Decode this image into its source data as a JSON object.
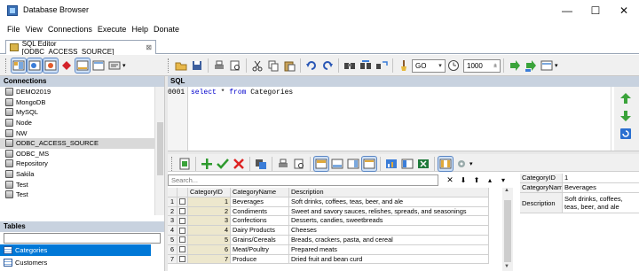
{
  "window": {
    "title": "Database Browser",
    "controls": [
      "—",
      "☐",
      "✕"
    ]
  },
  "menu": [
    "File",
    "View",
    "Connections",
    "Execute",
    "Help",
    "Donate"
  ],
  "tab": {
    "label": "SQL Editor [ODBC_ACCESS_SOURCE]",
    "close": "⊠"
  },
  "toolbar": {
    "go_value": "GO",
    "limit_value": "1000",
    "dropdown_arrow": "▾"
  },
  "connections": {
    "header": "Connections",
    "items": [
      "DEMO2019",
      "MongoDB",
      "MySQL",
      "Node",
      "NW",
      "ODBC_ACCESS_SOURCE",
      "ODBC_MS",
      "Repository",
      "Sakila",
      "Test",
      "Test"
    ],
    "selected": "ODBC_ACCESS_SOURCE"
  },
  "tables": {
    "header": "Tables",
    "filter_value": "",
    "items": [
      "Categories",
      "Customers"
    ],
    "selected": "Categories"
  },
  "sql": {
    "header": "SQL",
    "line_number": "0001",
    "keyword_select": "select",
    "star": " * ",
    "keyword_from": "from",
    "table": " Categories"
  },
  "grid": {
    "search_placeholder": "Search...",
    "columns": [
      "CategoryID",
      "CategoryName",
      "Description"
    ],
    "rows": [
      {
        "n": "1",
        "id": "1",
        "name": "Beverages",
        "desc": "Soft drinks, coffees, teas, beer, and ale"
      },
      {
        "n": "2",
        "id": "2",
        "name": "Condiments",
        "desc": "Sweet and savory sauces, relishes, spreads, and seasonings"
      },
      {
        "n": "3",
        "id": "3",
        "name": "Confections",
        "desc": "Desserts, candies, sweetbreads"
      },
      {
        "n": "4",
        "id": "4",
        "name": "Dairy Products",
        "desc": "Cheeses"
      },
      {
        "n": "5",
        "id": "5",
        "name": "Grains/Cereals",
        "desc": "Breads, crackers, pasta, and cereal"
      },
      {
        "n": "6",
        "id": "6",
        "name": "Meat/Poultry",
        "desc": "Prepared meats"
      },
      {
        "n": "7",
        "id": "7",
        "name": "Produce",
        "desc": "Dried fruit and bean curd"
      }
    ],
    "nav": [
      "✕",
      "⬇",
      "⬆",
      "▴",
      "▾"
    ]
  },
  "record": {
    "fields": [
      {
        "key": "CategoryID",
        "value": "1"
      },
      {
        "key": "CategoryName",
        "value": "Beverages"
      },
      {
        "key": "Description",
        "value": "Soft drinks, coffees, teas, beer, and ale"
      }
    ]
  },
  "colors": {
    "panel_header": "#c8d2df",
    "selection_blue": "#0078d7",
    "sql_keyword": "#0000cc",
    "id_column": "#ede7cd"
  }
}
